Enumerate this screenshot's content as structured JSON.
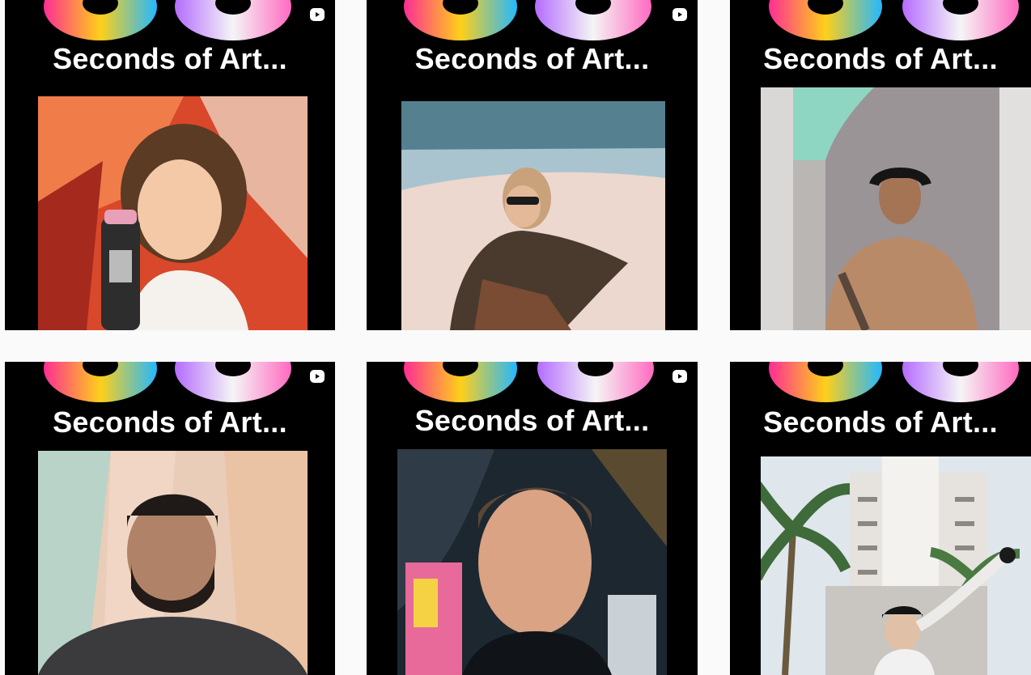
{
  "grid": {
    "tiles": [
      {
        "title": "Seconds of Art...",
        "has_reel_icon": true,
        "thumbnail_icon": "person-with-spray-can"
      },
      {
        "title": "Seconds of Art...",
        "has_reel_icon": true,
        "thumbnail_icon": "person-on-sand-dune"
      },
      {
        "title": "Seconds of Art...",
        "has_reel_icon": false,
        "thumbnail_icon": "person-against-wall"
      },
      {
        "title": "Seconds of Art...",
        "has_reel_icon": true,
        "thumbnail_icon": "person-bearded-portrait"
      },
      {
        "title": "Seconds of Art...",
        "has_reel_icon": true,
        "thumbnail_icon": "person-closeup-portrait"
      },
      {
        "title": "Seconds of Art...",
        "has_reel_icon": false,
        "thumbnail_icon": "person-painting-outdoors"
      }
    ]
  },
  "colors": {
    "page_background": "#fafafa",
    "tile_background": "#000000",
    "title_text": "#ffffff"
  }
}
